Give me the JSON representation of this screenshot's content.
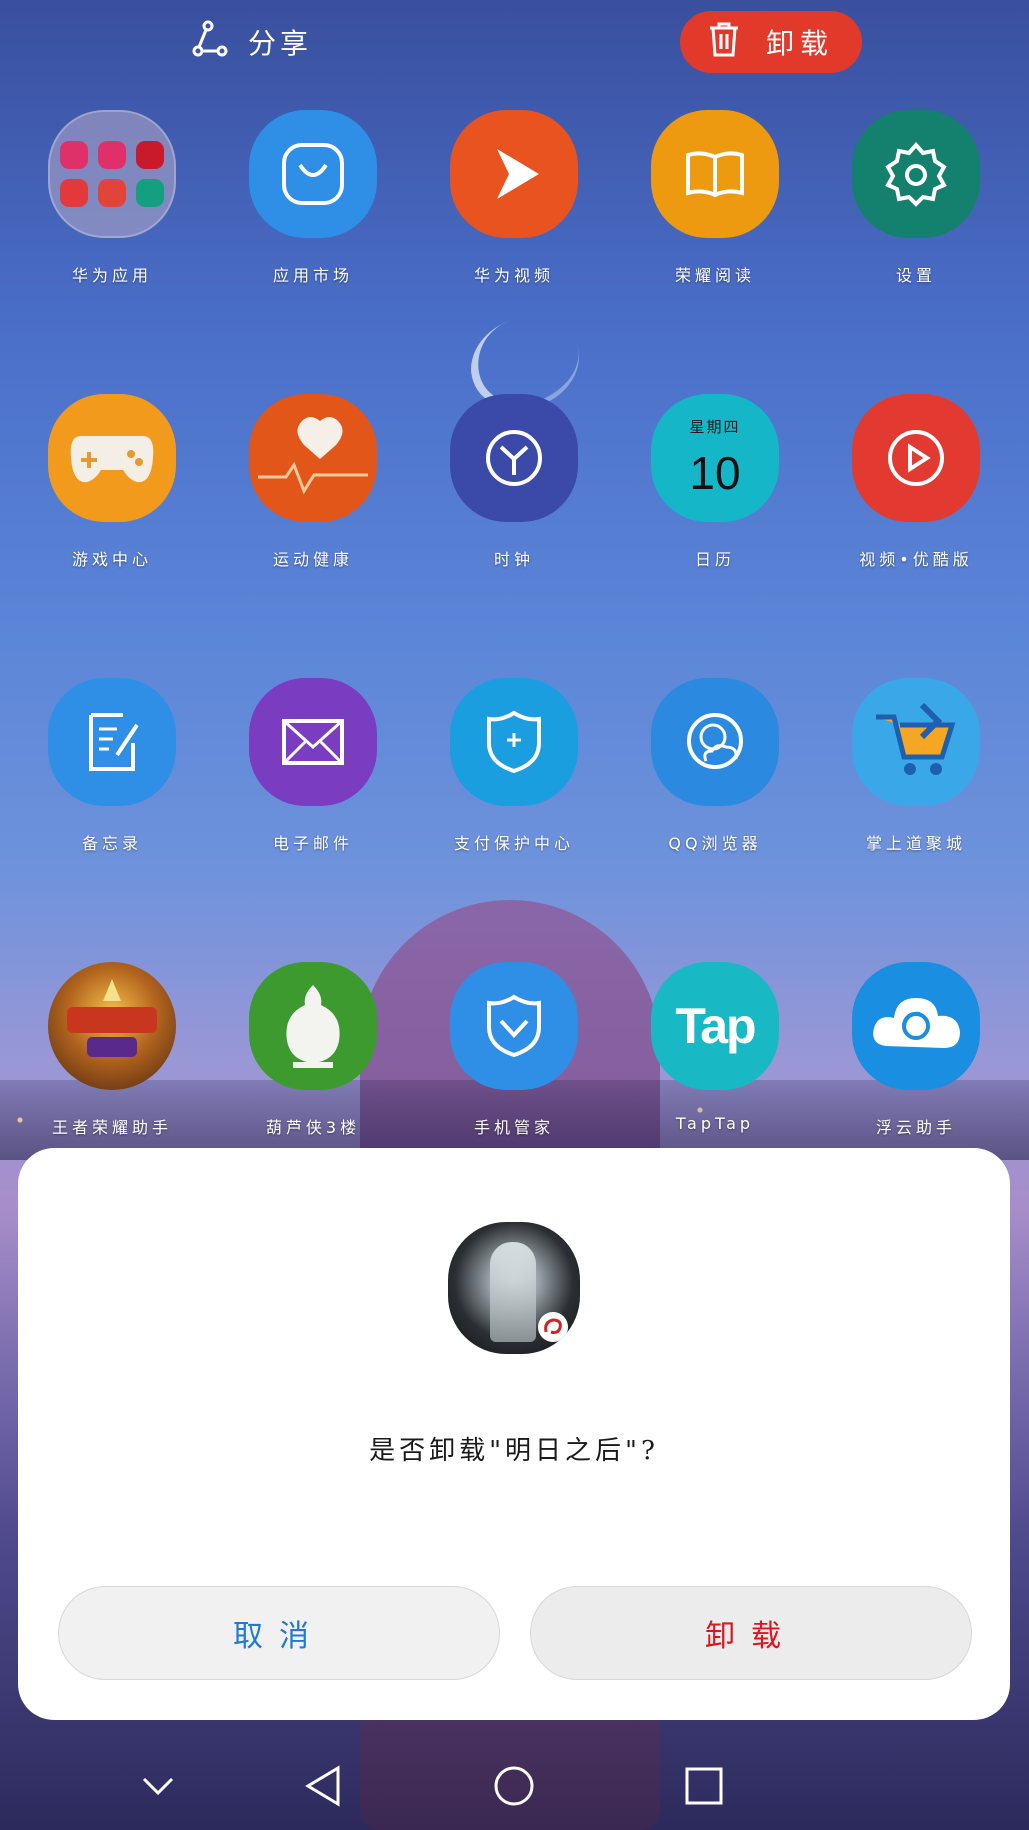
{
  "topbar": {
    "share_label": "分享",
    "share_icon": "share-icon",
    "uninstall_label": "卸载",
    "uninstall_icon": "trash-icon",
    "uninstall_color": "#e23a2a"
  },
  "apps": [
    {
      "label": "华为应用",
      "icon": "folder-icon",
      "color": "#b4aac8"
    },
    {
      "label": "应用市场",
      "icon": "app-market-icon",
      "color": "#2f8ee6"
    },
    {
      "label": "华为视频",
      "icon": "video-play-icon",
      "color": "#e8531f"
    },
    {
      "label": "荣耀阅读",
      "icon": "book-icon",
      "color": "#ee9a10"
    },
    {
      "label": "设置",
      "icon": "gear-icon",
      "color": "#14806e"
    },
    {
      "label": "游戏中心",
      "icon": "gamepad-icon",
      "color": "#f29a1b"
    },
    {
      "label": "运动健康",
      "icon": "heart-pulse-icon",
      "color": "#e2561a"
    },
    {
      "label": "时钟",
      "icon": "clock-icon",
      "color": "#3b4aa8"
    },
    {
      "label": "日历",
      "icon": "calendar-icon",
      "color": "#14b6c8",
      "day": "星期四",
      "date": "10"
    },
    {
      "label": "视频•优酷版",
      "icon": "play-circle-icon",
      "color": "#e23a30"
    },
    {
      "label": "备忘录",
      "icon": "memo-icon",
      "color": "#2f8ee6"
    },
    {
      "label": "电子邮件",
      "icon": "mail-icon",
      "color": "#7a3cc0"
    },
    {
      "label": "支付保护中心",
      "icon": "shield-icon",
      "color": "#1a9ee0"
    },
    {
      "label": "QQ浏览器",
      "icon": "browser-icon",
      "color": "#2b8ae0"
    },
    {
      "label": "掌上道聚城",
      "icon": "shopping-cart-icon",
      "color": "#3aa8e8"
    },
    {
      "label": "王者荣耀助手",
      "icon": "game-assistant-icon",
      "color": "#7a3a18"
    },
    {
      "label": "葫芦侠3楼",
      "icon": "gourd-icon",
      "color": "#3d9a2e"
    },
    {
      "label": "手机管家",
      "icon": "phone-manager-icon",
      "color": "#2f8ee6"
    },
    {
      "label": "TapTap",
      "icon": "taptap-icon",
      "color": "#18b9c4",
      "text": "Tap"
    },
    {
      "label": "浮云助手",
      "icon": "cloud-icon",
      "color": "#1a8ee0"
    }
  ],
  "dialog": {
    "app_icon": "app-icon-tomorrow",
    "message": "是否卸载\"明日之后\"?",
    "cancel_label": "取消",
    "confirm_label": "卸载",
    "cancel_color": "#1e7ad6",
    "confirm_color": "#e0141e"
  },
  "navbar": {
    "items": [
      "chevron-down-icon",
      "back-icon",
      "home-icon",
      "recents-icon"
    ]
  }
}
